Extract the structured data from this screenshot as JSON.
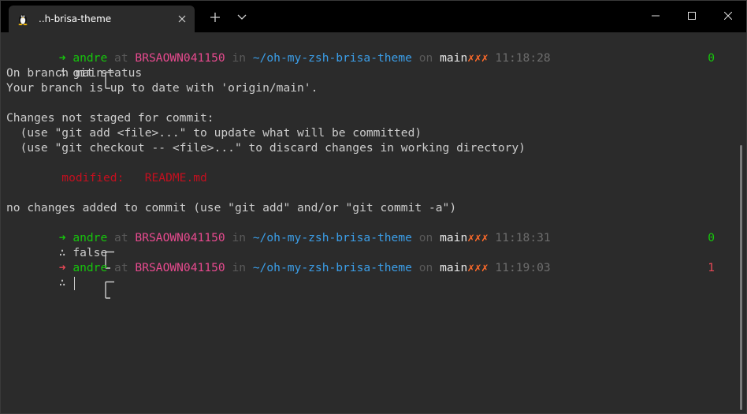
{
  "tab": {
    "title": "..h-brisa-theme",
    "icon": "tux-icon"
  },
  "window_controls": [
    "minimize-icon",
    "maximize-icon",
    "close-icon"
  ],
  "colors": {
    "prompt_ok": "#16c60c",
    "prompt_err": "#e74856",
    "host": "#e84a8f",
    "path": "#3b9ee8",
    "dirty_mark": "#ff6a2a",
    "modified": "#c50f1f"
  },
  "prompts": [
    {
      "arrow": "➜",
      "user": "andre",
      "at": "at",
      "host": "BRSAOWN041150",
      "in": "in",
      "path": "~/oh-my-zsh-brisa-theme",
      "on": "on",
      "branch": "main",
      "dirty": "✗✗✗",
      "time": "11:18:28",
      "command": "git status",
      "exit_code": "0"
    },
    {
      "arrow": "➜",
      "user": "andre",
      "at": "at",
      "host": "BRSAOWN041150",
      "in": "in",
      "path": "~/oh-my-zsh-brisa-theme",
      "on": "on",
      "branch": "main",
      "dirty": "✗✗✗",
      "time": "11:18:31",
      "command": "false",
      "exit_code": "0"
    },
    {
      "arrow": "➜",
      "user": "andre",
      "at": "at",
      "host": "BRSAOWN041150",
      "in": "in",
      "path": "~/oh-my-zsh-brisa-theme",
      "on": "on",
      "branch": "main",
      "dirty": "✗✗✗",
      "time": "11:19:03",
      "command": "",
      "exit_code": "1"
    }
  ],
  "prompt_symbol": "∴",
  "output": {
    "l1": "On branch main",
    "l2": "Your branch is up to date with 'origin/main'.",
    "l3": "Changes not staged for commit:",
    "l4": "  (use \"git add <file>...\" to update what will be committed)",
    "l5": "  (use \"git checkout -- <file>...\" to discard changes in working directory)",
    "modified_label": "modified:",
    "modified_file": "README.md",
    "l7": "no changes added to commit (use \"git add\" and/or \"git commit -a\")"
  }
}
